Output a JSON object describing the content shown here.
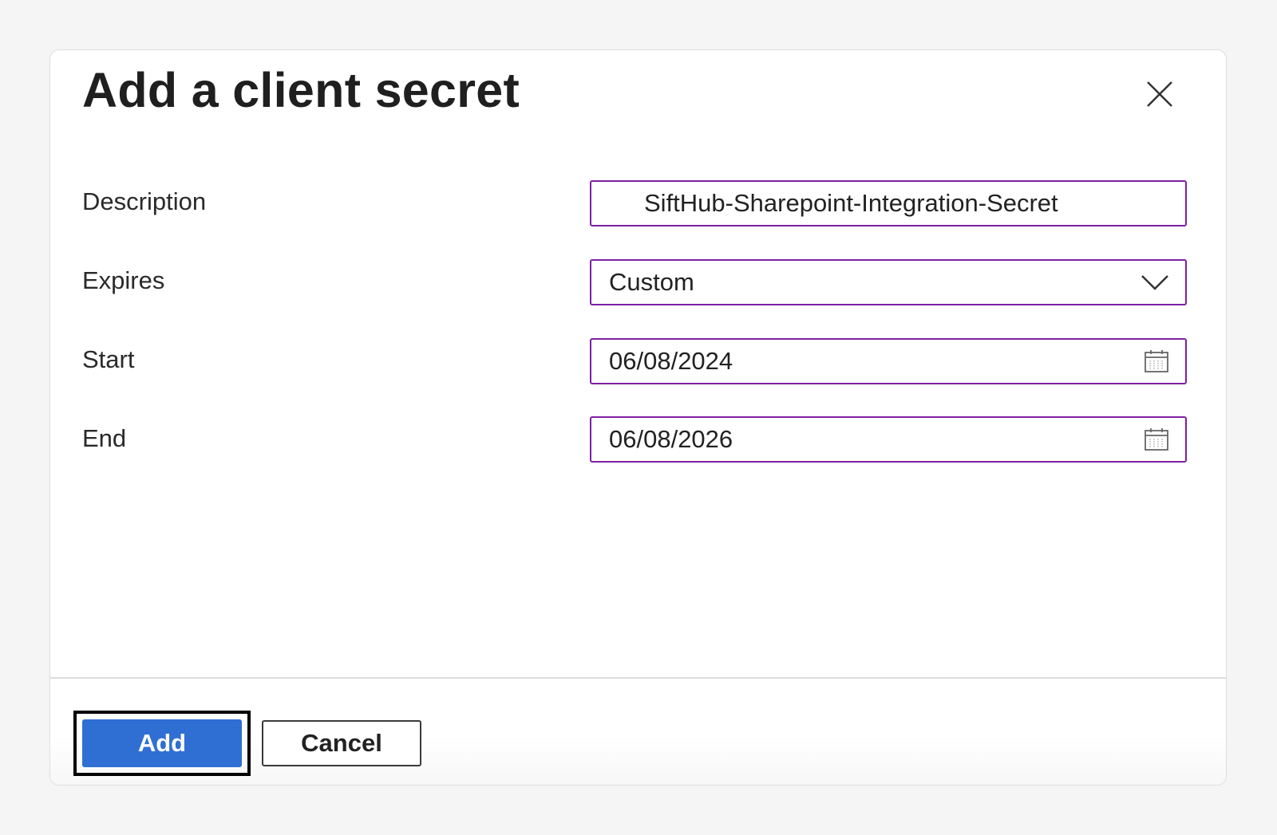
{
  "dialog": {
    "title": "Add a client secret",
    "close_icon": "close-icon"
  },
  "form": {
    "description": {
      "label": "Description",
      "value": "SiftHub-Sharepoint-Integration-Secret"
    },
    "expires": {
      "label": "Expires",
      "value": "Custom",
      "icon": "chevron-down-icon"
    },
    "start": {
      "label": "Start",
      "value": "06/08/2024",
      "icon": "calendar-icon"
    },
    "end": {
      "label": "End",
      "value": "06/08/2026",
      "icon": "calendar-icon"
    }
  },
  "footer": {
    "add_label": "Add",
    "cancel_label": "Cancel"
  },
  "colors": {
    "field_border": "#7d1fa3",
    "primary_button": "#2f6fd3",
    "focus_outline": "#000000"
  }
}
